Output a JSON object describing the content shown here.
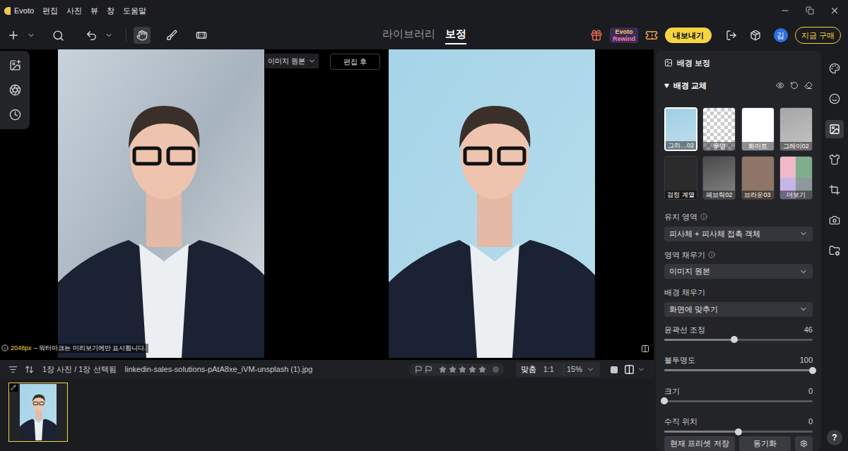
{
  "app": {
    "name": "Evoto"
  },
  "menu": [
    "편집",
    "사진",
    "뷰",
    "창",
    "도움말"
  ],
  "tools": [
    {
      "selected": true
    },
    {
      "selected": false
    },
    {
      "selected": false
    }
  ],
  "mode_tabs": [
    {
      "label": "라이브러리",
      "selected": false
    },
    {
      "label": "보정",
      "selected": true
    }
  ],
  "rewind_badge": {
    "line1": "Evoto",
    "line2": "Rewind"
  },
  "export_button": "내보내기",
  "avatar": "김",
  "buy_button": "지금 구매",
  "left_tools": [
    {
      "selected": false
    },
    {
      "selected": false
    },
    {
      "selected": false
    }
  ],
  "canvas": {
    "before_label": "이미지 원본",
    "after_button": "편집 후",
    "info_size": "2048px",
    "info_note": "– 워터마크는 미리보기에만 표시됩니다."
  },
  "filmbar": {
    "count": "1장 사진 / 1장 선택됨",
    "filename": "linkedin-sales-solutions-pAtA8xe_iVM-unsplash (1).jpg",
    "stars": 0,
    "zoom_options": [
      {
        "label": "맞춤",
        "selected": true
      },
      {
        "label": "1:1",
        "selected": false
      }
    ],
    "zoom": "15%"
  },
  "filmstrip": [
    {
      "selected": true
    }
  ],
  "panel": {
    "title": "배경 보정",
    "section": "배경 교체",
    "expanded": true,
    "swatches": [
      {
        "label": "그라…02",
        "selected": true,
        "kind": "gradient",
        "color": "#9fcfe3"
      },
      {
        "label": "투명",
        "selected": false,
        "kind": "transparent",
        "color": "#d9d9d9"
      },
      {
        "label": "화이트",
        "selected": false,
        "kind": "solid",
        "color": "#ffffff"
      },
      {
        "label": "그레이02",
        "selected": false,
        "kind": "gradient",
        "color": "#a6a6a6"
      },
      {
        "label": "검정 계열",
        "selected": false,
        "kind": "solid",
        "color": "#2b2b2b"
      },
      {
        "label": "페브릭02",
        "selected": false,
        "kind": "gradient",
        "color": "#4a4a4a"
      },
      {
        "label": "브라운03",
        "selected": false,
        "kind": "solid",
        "color": "#8e7567"
      },
      {
        "label": "더보기",
        "selected": false,
        "kind": "more",
        "color": "#f0b8c8",
        "colors": [
          "#f0b8c8",
          "#7fae8f",
          "#c7b5e8",
          "#8e9a9a"
        ]
      }
    ],
    "fields": [
      {
        "label": "유지 영역",
        "help": true,
        "value": "피사체 + 피사체 접촉 객체"
      },
      {
        "label": "영역 채우기",
        "help": true,
        "value": "이미지 원본"
      },
      {
        "label": "배경 채우기",
        "help": false,
        "value": "화면에 맞추기"
      }
    ],
    "sliders": [
      {
        "label": "윤곽선 조정",
        "reading": "46",
        "level": 0.47
      },
      {
        "label": "불투명도",
        "reading": "100",
        "level": 1
      },
      {
        "label": "크기",
        "reading": "0",
        "level": 0
      },
      {
        "label": "수직 위치",
        "reading": "0",
        "level": 0.5
      }
    ],
    "buttons": [
      "현재 프리셋 저장",
      "동기화"
    ]
  },
  "side_icons": [
    {
      "selected": false
    },
    {
      "selected": false
    },
    {
      "selected": true
    },
    {
      "selected": false
    },
    {
      "selected": false
    },
    {
      "selected": false
    },
    {
      "selected": false
    }
  ],
  "help": "?"
}
